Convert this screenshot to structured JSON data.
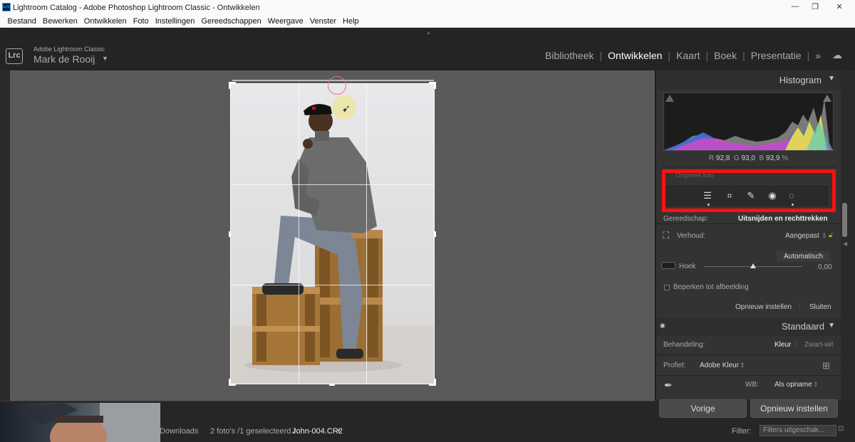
{
  "window": {
    "title": "Lightroom Catalog - Adobe Photoshop Lightroom Classic - Ontwikkelen",
    "app_icon": "Lrc",
    "minimize": "—",
    "restore": "❐",
    "close": "✕"
  },
  "menu": [
    "Bestand",
    "Bewerken",
    "Ontwikkelen",
    "Foto",
    "Instellingen",
    "Gereedschappen",
    "Weergave",
    "Venster",
    "Help"
  ],
  "identity": {
    "logo": "Lrc",
    "app_name": "Adobe Lightroom Classic",
    "user_name": "Mark de Rooij",
    "user_arrow": "▼"
  },
  "modules": {
    "items": [
      "Bibliotheek",
      "Ontwikkelen",
      "Kaart",
      "Boek",
      "Presentatie"
    ],
    "active": "Ontwikkelen",
    "more": "»",
    "cloud": "☁"
  },
  "histogram": {
    "header": "Histogram",
    "header_arrow": "▼",
    "r_label": "R",
    "r_value": "92,8",
    "g_label": "G",
    "g_value": "93,0",
    "b_label": "B",
    "b_value": "93,9",
    "unit": "%",
    "faint_label": "Origineel foto"
  },
  "tools": [
    "sliders-icon",
    "crop-icon",
    "healing-icon",
    "red-eye-icon",
    "mask-icon"
  ],
  "crop_panel": {
    "tool_label": "Gereedschap:",
    "tool_value": "Uitsnijden en rechttrekken",
    "ratio_label": "Verhoud:",
    "ratio_value": "Aangepast",
    "auto_button": "Automatisch",
    "angle_label": "Hoek",
    "angle_value": "0,00",
    "angle_slider_level": 0.5,
    "constrain_label": "Beperken tot afbeelding",
    "reset_label": "Opnieuw instellen",
    "close_label": "Sluiten"
  },
  "basic_panel": {
    "header": "Standaard",
    "header_arrow": "▼",
    "treatment_label": "Behandeling:",
    "treatment_color": "Kleur",
    "treatment_bw": "Zwart-wit",
    "profile_label": "Profiel:",
    "profile_value": "Adobe Kleur",
    "wb_label": "WB:",
    "wb_value": "Als opname"
  },
  "bottom_buttons": {
    "previous": "Vorige",
    "reset": "Opnieuw instellen"
  },
  "filmstrip": {
    "source": "Downloads",
    "info_prefix": "2 foto's /1 geselecteerd /",
    "filename": "John-004.CR2",
    "filename_suffix": "▾",
    "filter_label": "Filter:",
    "filter_value": "Filters uitgeschak..."
  },
  "colors": {
    "highlight": "#ff1010",
    "panel": "#333333",
    "canvas": "#5a5a5a"
  }
}
